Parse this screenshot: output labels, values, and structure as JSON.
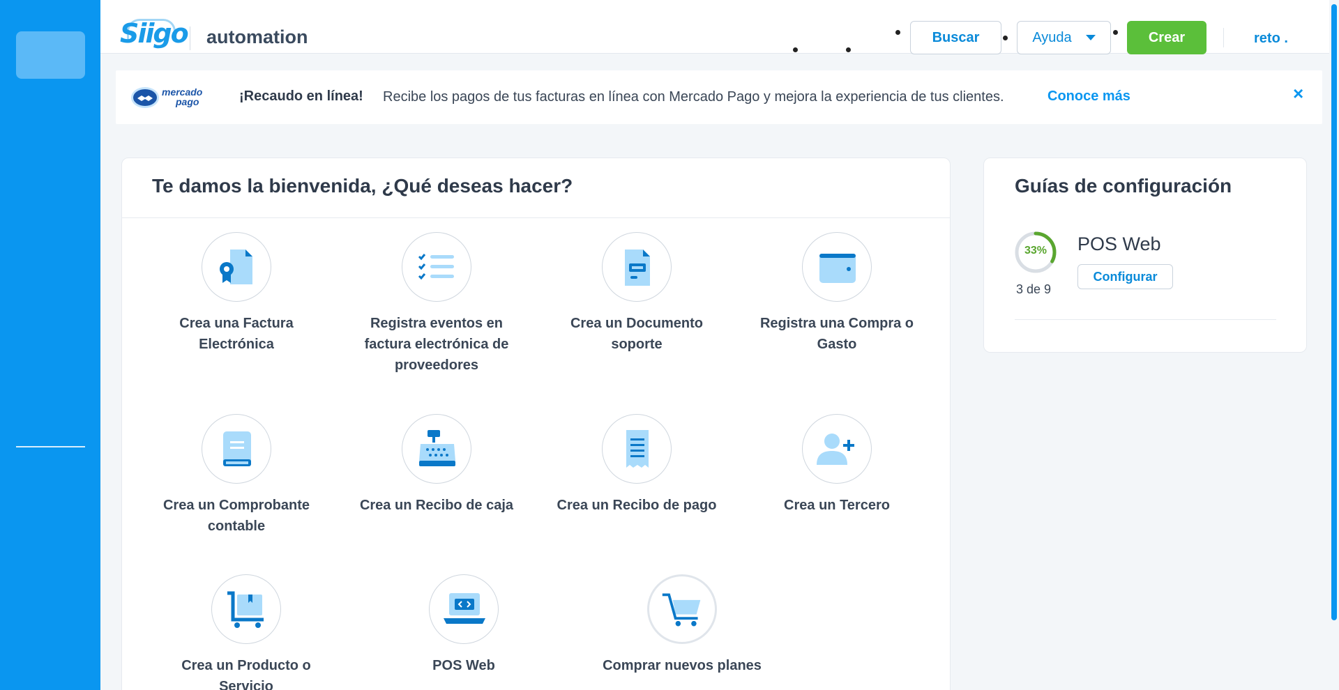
{
  "header": {
    "brand": "Siigo",
    "company": "automation",
    "search_label": "Buscar",
    "help_label": "Ayuda",
    "create_label": "Crear",
    "user": "reto ."
  },
  "banner": {
    "logo_text_1": "mercado",
    "logo_text_2": "pago",
    "title": "¡Recaudo en línea!",
    "text": "Recibe los pagos de tus facturas en línea con Mercado Pago y mejora la experiencia de tus clientes.",
    "link": "Conoce más",
    "close": "×"
  },
  "welcome": {
    "title": "Te damos la bienvenida, ¿Qué deseas hacer?",
    "actions": [
      {
        "label": "Crea una Factura Electrónica",
        "icon": "invoice-icon"
      },
      {
        "label": "Registra eventos en factura electrónica de proveedores",
        "icon": "checklist-icon"
      },
      {
        "label": "Crea un Documento soporte",
        "icon": "document-icon"
      },
      {
        "label": "Registra una Compra o Gasto",
        "icon": "wallet-icon"
      },
      {
        "label": "Crea un Comprobante contable",
        "icon": "ledger-icon"
      },
      {
        "label": "Crea un Recibo de caja",
        "icon": "cash-register-icon"
      },
      {
        "label": "Crea un Recibo de pago",
        "icon": "receipt-icon"
      },
      {
        "label": "Crea un Tercero",
        "icon": "add-user-icon"
      },
      {
        "label": "Crea un Producto o Servicio",
        "icon": "cart-box-icon"
      },
      {
        "label": "POS Web",
        "icon": "code-laptop-icon"
      },
      {
        "label": "Comprar nuevos planes",
        "icon": "shopping-cart-icon"
      }
    ]
  },
  "guides": {
    "title": "Guías de configuración",
    "progress_pct": "33%",
    "progress_fraction": 0.33,
    "count": "3 de 9",
    "name": "POS Web",
    "button": "Configurar"
  },
  "colors": {
    "primary": "#0a96f0",
    "create_button": "#5bbf3a",
    "progress": "#5aa62f",
    "icon_light": "#a9dbfb",
    "icon_dark": "#0a78c8"
  }
}
